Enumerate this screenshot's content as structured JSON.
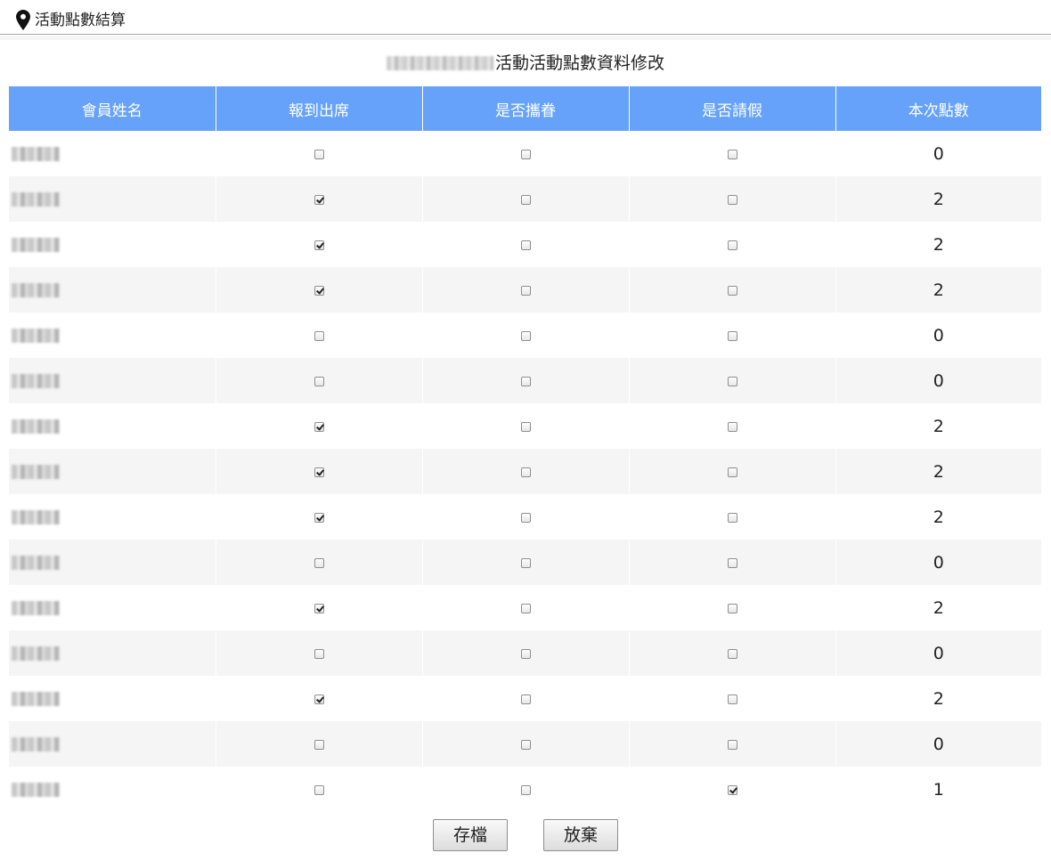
{
  "header": {
    "title": "活動點數結算",
    "icon": "map-pin-icon"
  },
  "page_heading": {
    "suffix": "活動活動點數資料修改"
  },
  "table": {
    "columns": [
      "會員姓名",
      "報到出席",
      "是否攜眷",
      "是否請假",
      "本次點數"
    ],
    "rows": [
      {
        "attend": false,
        "family": false,
        "leave": false,
        "points": "0"
      },
      {
        "attend": true,
        "family": false,
        "leave": false,
        "points": "2"
      },
      {
        "attend": true,
        "family": false,
        "leave": false,
        "points": "2"
      },
      {
        "attend": true,
        "family": false,
        "leave": false,
        "points": "2"
      },
      {
        "attend": false,
        "family": false,
        "leave": false,
        "points": "0"
      },
      {
        "attend": false,
        "family": false,
        "leave": false,
        "points": "0"
      },
      {
        "attend": true,
        "family": false,
        "leave": false,
        "points": "2"
      },
      {
        "attend": true,
        "family": false,
        "leave": false,
        "points": "2"
      },
      {
        "attend": true,
        "family": false,
        "leave": false,
        "points": "2"
      },
      {
        "attend": false,
        "family": false,
        "leave": false,
        "points": "0"
      },
      {
        "attend": true,
        "family": false,
        "leave": false,
        "points": "2"
      },
      {
        "attend": false,
        "family": false,
        "leave": false,
        "points": "0"
      },
      {
        "attend": true,
        "family": false,
        "leave": false,
        "points": "2"
      },
      {
        "attend": false,
        "family": false,
        "leave": false,
        "points": "0"
      },
      {
        "attend": false,
        "family": false,
        "leave": true,
        "points": "1"
      }
    ]
  },
  "buttons": {
    "save": "存檔",
    "discard": "放棄"
  },
  "colors": {
    "header_bg": "#66a2fa",
    "stripe": "#f5f5f5"
  }
}
